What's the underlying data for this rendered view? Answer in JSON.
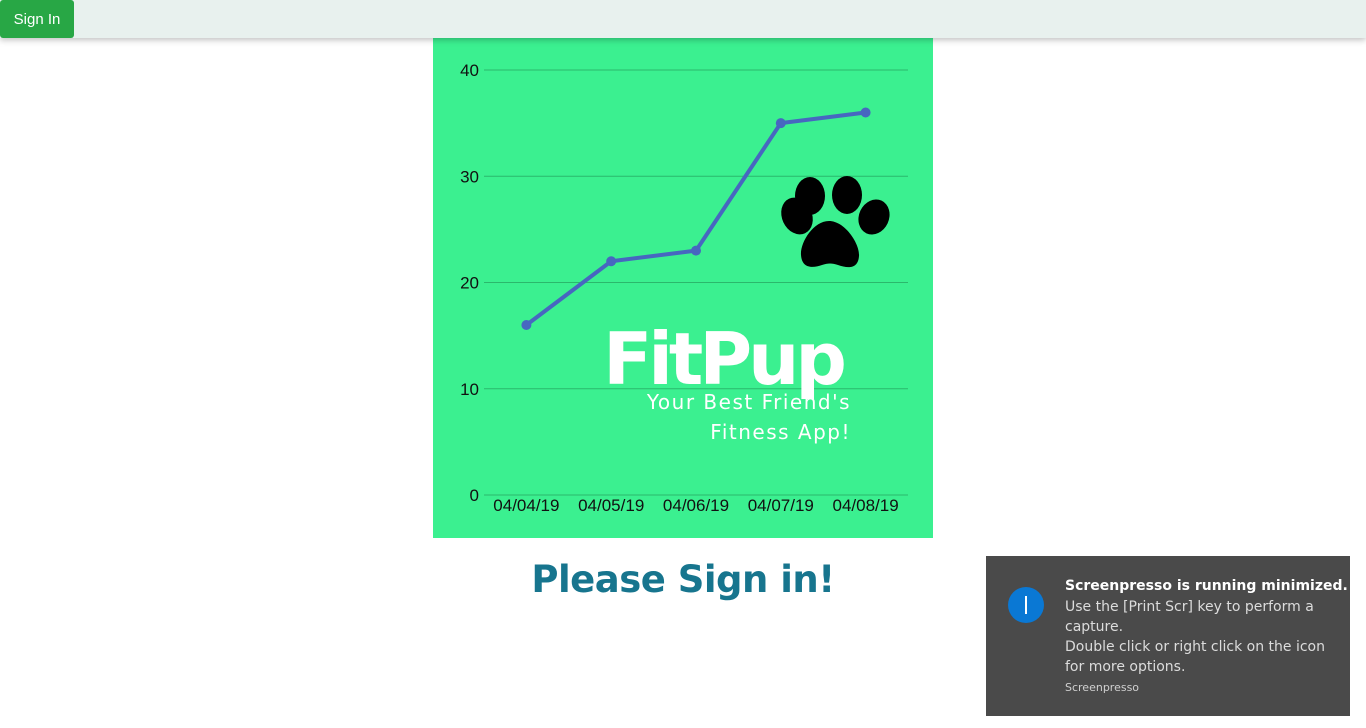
{
  "header": {
    "signin_label": "Sign In"
  },
  "logo": {
    "name": "FitPup",
    "tagline_line1": "Your Best Friend's",
    "tagline_line2": "Fitness App!"
  },
  "main": {
    "heading": "Please Sign in!"
  },
  "toast": {
    "title": "Screenpresso is running minimized.",
    "line1": "Use the [Print Scr] key to perform a",
    "line2": "capture.",
    "line3": "Double click or right click on the icon",
    "line4": "for more options.",
    "source": "Screenpresso"
  },
  "colors": {
    "header_bg": "#e8f1ee",
    "signin_bg": "#28a745",
    "chart_bg": "#3bf090",
    "line": "#4767c0",
    "heading": "#17758e",
    "toast_bg": "#4a4a4a",
    "info_icon": "#0a78d4"
  },
  "icons": [
    "paw-icon",
    "info-icon"
  ],
  "chart_data": {
    "type": "line",
    "categories": [
      "04/04/19",
      "04/05/19",
      "04/06/19",
      "04/07/19",
      "04/08/19"
    ],
    "values": [
      16,
      22,
      23,
      35,
      36
    ],
    "yticks": [
      0,
      10,
      20,
      30,
      40
    ],
    "ylim": [
      0,
      40
    ],
    "grid": true,
    "title": "",
    "xlabel": "",
    "ylabel": ""
  }
}
